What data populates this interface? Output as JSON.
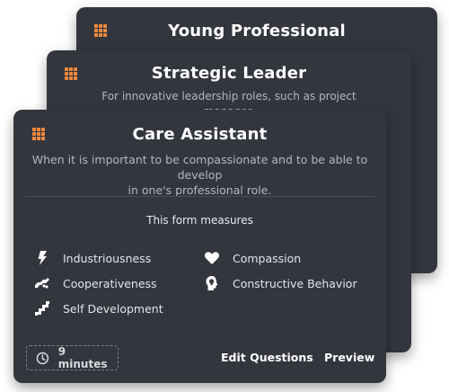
{
  "cards": {
    "back": {
      "title": "Young Professional",
      "icon": "grid-icon"
    },
    "middle": {
      "title": "Strategic Leader",
      "description": "For innovative leadership roles, such as project manager.",
      "icon": "grid-icon"
    },
    "front": {
      "title": "Care Assistant",
      "description_line1": "When it is important to be compassionate and to be able to develop",
      "description_line2": "in one's professional role.",
      "measures_title": "This form measures",
      "measures": [
        {
          "label": "Industriousness",
          "icon": "lightning-icon"
        },
        {
          "label": "Compassion",
          "icon": "heart-icon"
        },
        {
          "label": "Cooperativeness",
          "icon": "handshake-icon"
        },
        {
          "label": "Constructive Behavior",
          "icon": "head-lightbulb-icon"
        },
        {
          "label": "Self Development",
          "icon": "stairs-icon"
        }
      ],
      "duration": "9 minutes",
      "edit_label": "Edit Questions",
      "preview_label": "Preview"
    }
  },
  "colors": {
    "card_bg": "#33363d",
    "accent": "#ef8a3f",
    "text_primary": "#ffffff",
    "text_secondary": "#b4b7bd"
  }
}
